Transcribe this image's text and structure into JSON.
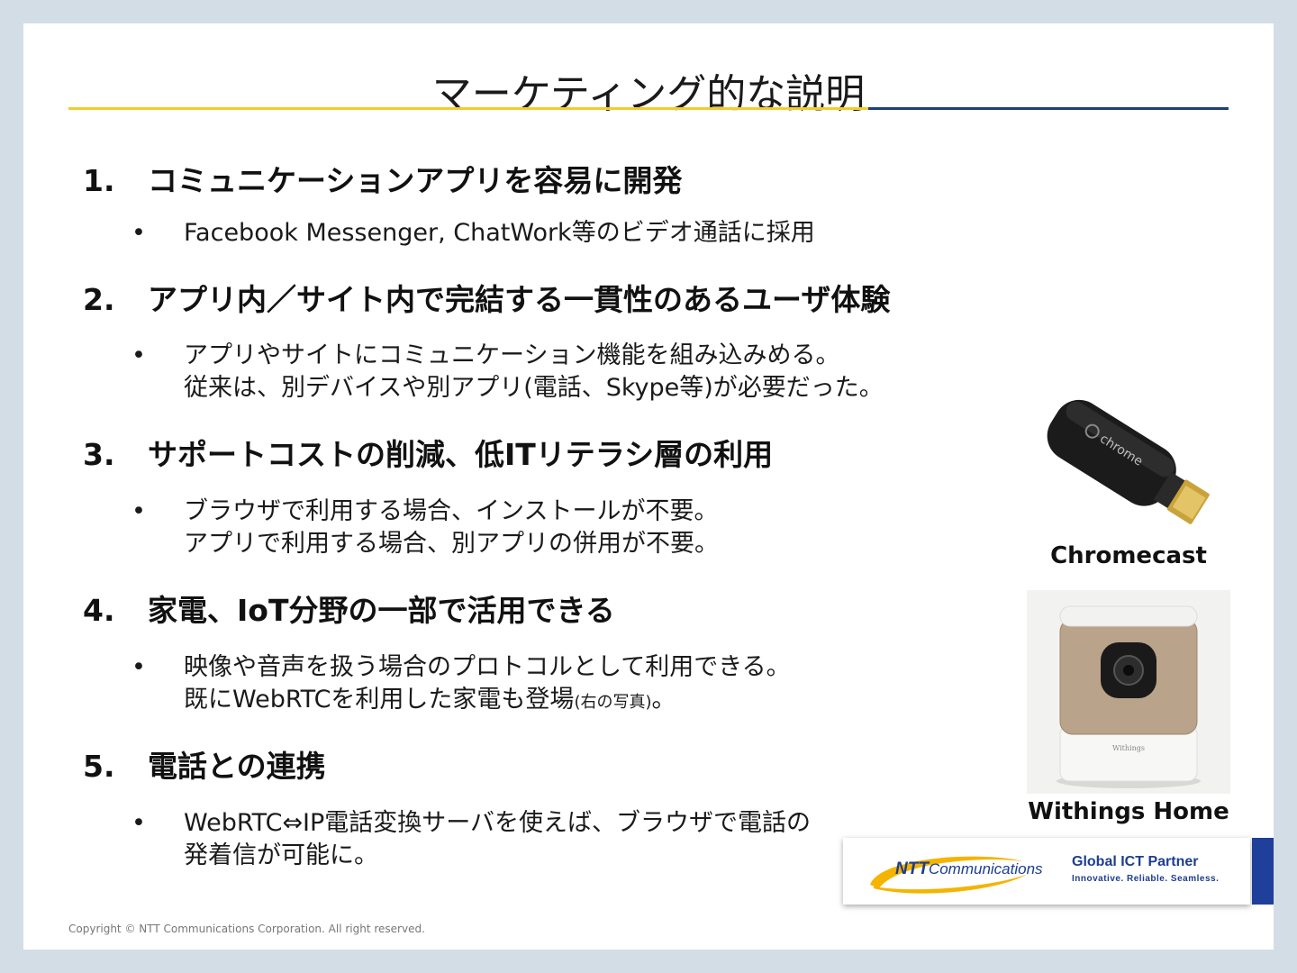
{
  "title": "マーケティング的な説明",
  "items": [
    {
      "num": "1.",
      "heading": "コミュニケーションアプリを容易に開発",
      "bullet_lines": [
        "Facebook Messenger, ChatWork等のビデオ通話に採用"
      ]
    },
    {
      "num": "2.",
      "heading": "アプリ内／サイト内で完結する一貫性のあるユーザ体験",
      "bullet_lines": [
        "アプリやサイトにコミュニケーション機能を組み込みめる。",
        "従来は、別デバイスや別アプリ(電話、Skype等)が必要だった。"
      ]
    },
    {
      "num": "3.",
      "heading": "サポートコストの削減、低ITリテラシ層の利用",
      "bullet_lines": [
        "ブラウザで利用する場合、インストールが不要。",
        "アプリで利用する場合、別アプリの併用が不要。"
      ]
    },
    {
      "num": "4.",
      "heading": "家電、IoT分野の一部で活用できる",
      "bullet_lines": [
        "映像や音声を扱う場合のプロトコルとして利用できる。",
        "既にWebRTCを利用した家電も登場"
      ],
      "bullet_small": "(右の写真)",
      "bullet_tail": "。"
    },
    {
      "num": "5.",
      "heading": "電話との連携",
      "bullet_lines": [
        "WebRTC⇔IP電話変換サーバを使えば、ブラウザで電話の",
        "発着信が可能に。"
      ]
    }
  ],
  "bullet_symbol": "•",
  "images": {
    "chromecast": {
      "caption": "Chromecast",
      "label": "chrome"
    },
    "withings": {
      "caption": "Withings Home",
      "label": "Withings"
    }
  },
  "footer": {
    "copyright": "Copyright © NTT Communications Corporation. All right reserved.",
    "logo_ntt": "NTT",
    "logo_comm": "Communications",
    "partner": "Global ICT Partner",
    "partner_sub": "Innovative. Reliable. Seamless."
  },
  "colors": {
    "accent_yellow": "#f2cc2f",
    "accent_blue": "#1e3f7a",
    "brand_blue": "#1d3d8f"
  }
}
